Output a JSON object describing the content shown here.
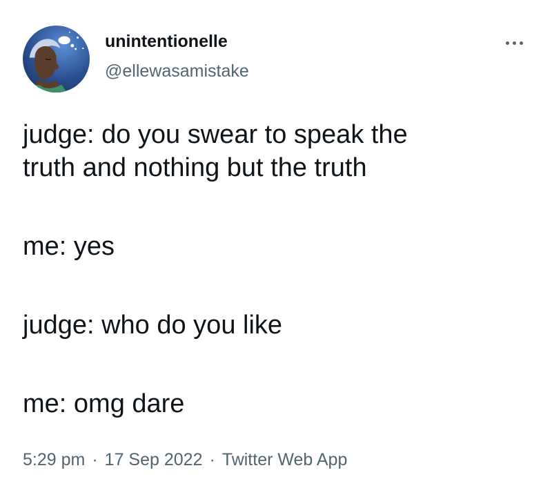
{
  "user": {
    "display_name": "unintentionelle",
    "handle": "@ellewasamistake"
  },
  "icons": {
    "more": "more-horizontal-icon"
  },
  "tweet": {
    "paragraphs": [
      [
        "judge: do you swear to speak the",
        "truth and nothing but the truth"
      ],
      [
        "me: yes"
      ],
      [
        "judge: who do you like"
      ],
      [
        "me: omg dare"
      ]
    ]
  },
  "meta": {
    "time": "5:29 pm",
    "separator": "·",
    "date": "17 Sep 2022",
    "source": "Twitter Web App"
  },
  "colors": {
    "text_primary": "#0f1419",
    "text_secondary": "#536471",
    "background": "#ffffff"
  }
}
